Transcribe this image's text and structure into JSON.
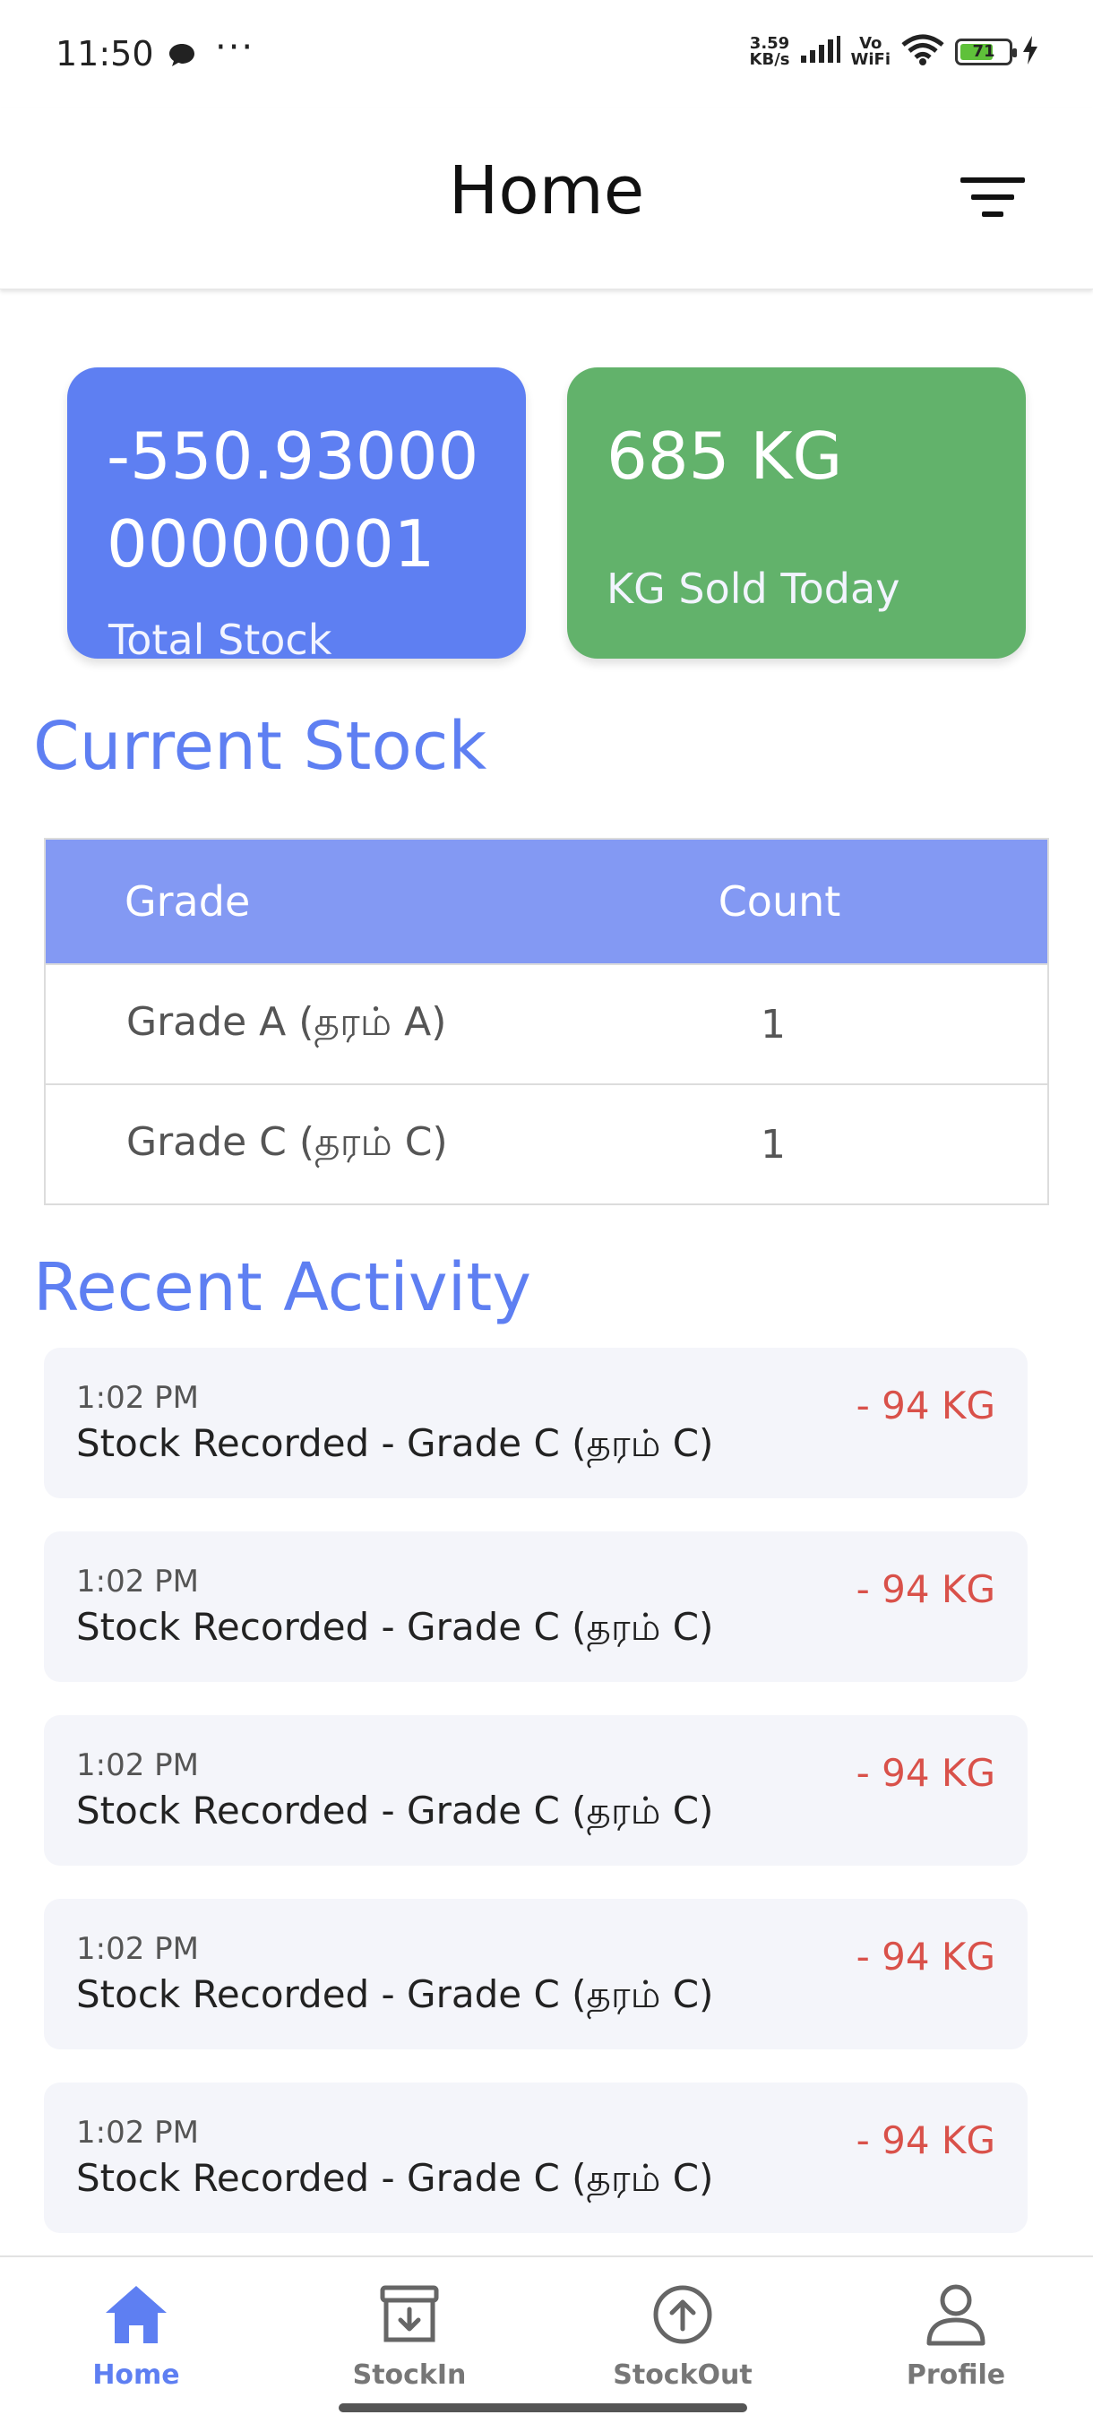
{
  "status_bar": {
    "time": "11:50",
    "net_speed_value": "3.59",
    "net_speed_unit": "KB/s",
    "vowifi_top": "Vo",
    "vowifi_bottom": "WiFi",
    "battery_level": "71"
  },
  "header": {
    "title": "Home",
    "filter_icon": "filter-icon"
  },
  "cards": {
    "total_stock": {
      "value": "-550.9300000000001",
      "label": "Total Stock",
      "color": "#5e7ff2"
    },
    "sold_today": {
      "value": "685 KG",
      "label": "KG Sold Today",
      "color": "#62b26b"
    }
  },
  "current_stock": {
    "title": "Current Stock",
    "columns": [
      "Grade",
      "Count"
    ],
    "rows": [
      {
        "grade": "Grade A (தரம் A)",
        "count": "1"
      },
      {
        "grade": "Grade C (தரம் C)",
        "count": "1"
      }
    ]
  },
  "recent_activity": {
    "title": "Recent Activity",
    "items": [
      {
        "time": "1:02 PM",
        "description": "Stock Recorded - Grade C (தரம் C)",
        "amount": "- 94 KG"
      },
      {
        "time": "1:02 PM",
        "description": "Stock Recorded - Grade C (தரம் C)",
        "amount": "- 94 KG"
      },
      {
        "time": "1:02 PM",
        "description": "Stock Recorded - Grade C (தரம் C)",
        "amount": "- 94 KG"
      },
      {
        "time": "1:02 PM",
        "description": "Stock Recorded - Grade C (தரம் C)",
        "amount": "- 94 KG"
      },
      {
        "time": "1:02 PM",
        "description": "Stock Recorded - Grade C (தரம் C)",
        "amount": "- 94 KG"
      }
    ]
  },
  "bottom_nav": {
    "items": [
      {
        "label": "Home",
        "icon": "home-icon",
        "active": true
      },
      {
        "label": "StockIn",
        "icon": "archive-down-icon",
        "active": false
      },
      {
        "label": "StockOut",
        "icon": "arrow-up-circle-icon",
        "active": false
      },
      {
        "label": "Profile",
        "icon": "user-icon",
        "active": false
      }
    ]
  },
  "colors": {
    "accent": "#5e7ff2",
    "table_header": "#8399f3",
    "negative": "#d9514a",
    "activity_bg": "#f4f5fa"
  }
}
